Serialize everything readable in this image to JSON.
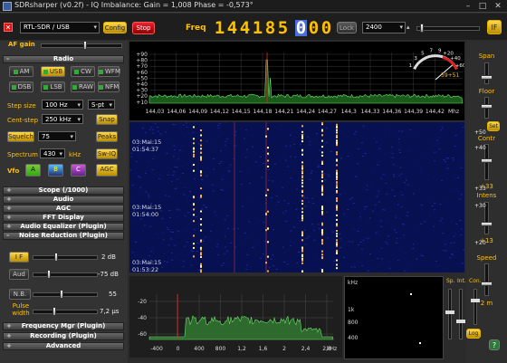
{
  "window": {
    "title": "SDRsharper (v0.2f) - IQ Imbalance: Gain = 1,008 Phase = -0,573°"
  },
  "toolbar": {
    "source": "RTL-SDR / USB",
    "config": "Config",
    "stop": "Stop",
    "freq_label": "Freq",
    "freq_digits": [
      "1",
      "4",
      "4",
      "1",
      "8",
      "5",
      "0",
      "0",
      "0"
    ],
    "lock": "Lock",
    "step_value": "2400",
    "if_btn": "IF"
  },
  "left": {
    "af_gain": "AF gain",
    "radio_hdr": "Radio",
    "modes": [
      "AM",
      "USB",
      "CW",
      "WFM",
      "DSB",
      "LSB",
      "RAW",
      "NFM"
    ],
    "step_size_lbl": "Step size",
    "step_size": "100 Hz",
    "s_pt": "S-pt",
    "cent_step_lbl": "Cent-step",
    "cent_step": "250 kHz",
    "snap": "Snap",
    "squelch": "Squelch",
    "squelch_val": "75",
    "peaks": "Peaks",
    "spectrum_lbl": "Spectrum",
    "spectrum_val": "430",
    "spectrum_unit": "kHz",
    "sw_iq": "Sw-IQ",
    "vfo": "Vfo",
    "vfo_btns": [
      "A",
      "B",
      "C"
    ],
    "agc_btn": "AGC",
    "sections": [
      "Scope (/1000)",
      "Audio",
      "AGC",
      "FFT Display",
      "Audio Equalizer (Plugin)",
      "Noise Reduction (Plugin)"
    ],
    "if_lbl": "I F",
    "if_db": "2 dB",
    "aud_lbl": "Aud",
    "aud_db": "-75 dB",
    "nb_lbl": "N.B.",
    "nb_val": "55",
    "pulse_lbl": "Pulse width",
    "pulse_val": "7,2 µs",
    "sections2": [
      "Frequency Mgr (Plugin)",
      "Recording (Plugin)",
      "Advanced"
    ]
  },
  "spectrum": {
    "y_ticks": [
      "+90",
      "+80",
      "+70",
      "+60",
      "+50",
      "+40",
      "+30",
      "+20",
      "+10"
    ],
    "x_ticks": [
      "144,03",
      "144,06",
      "144,09",
      "144,12",
      "144,15",
      "144,18",
      "144,21",
      "144,24",
      "144,27",
      "144,3",
      "144,33",
      "144,36",
      "144,39",
      "144,42"
    ],
    "x_unit": "Mhz",
    "meter_scale": [
      "1",
      "3",
      "5",
      "7",
      "9",
      "+20",
      "+40",
      "+60"
    ],
    "meter_reading": "59+51"
  },
  "waterfall": {
    "timestamps": [
      {
        "date": "03:Mai:15",
        "time": "01:54:37"
      },
      {
        "date": "03:Mai:15",
        "time": "01:54:00"
      },
      {
        "date": "03:Mai:15",
        "time": "01:53:22"
      }
    ],
    "color_scale": [
      "+50",
      "+40",
      "+33",
      "+30",
      "+20"
    ]
  },
  "right": {
    "span": "Span",
    "floor": "Floor",
    "set_btn": "Set",
    "contr": "Contr",
    "contr_val": "+33",
    "intens": "Intens",
    "intens_val": "+13",
    "speed": "Speed",
    "speed_val": "2 m"
  },
  "bottom": {
    "y_ticks": [
      "-20",
      "-40",
      "-60"
    ],
    "x_ticks": [
      "-400",
      "0",
      "400",
      "800",
      "1,2",
      "1,6",
      "2",
      "2,4",
      "2,8"
    ],
    "x_unit": "kHz",
    "scope_unit": "kHz",
    "scope_ticks": [
      "1k",
      "800",
      "400"
    ],
    "sliders": [
      "Sp.",
      "Int.",
      "Con."
    ],
    "log_btn": "Log",
    "help_btn": "?"
  }
}
